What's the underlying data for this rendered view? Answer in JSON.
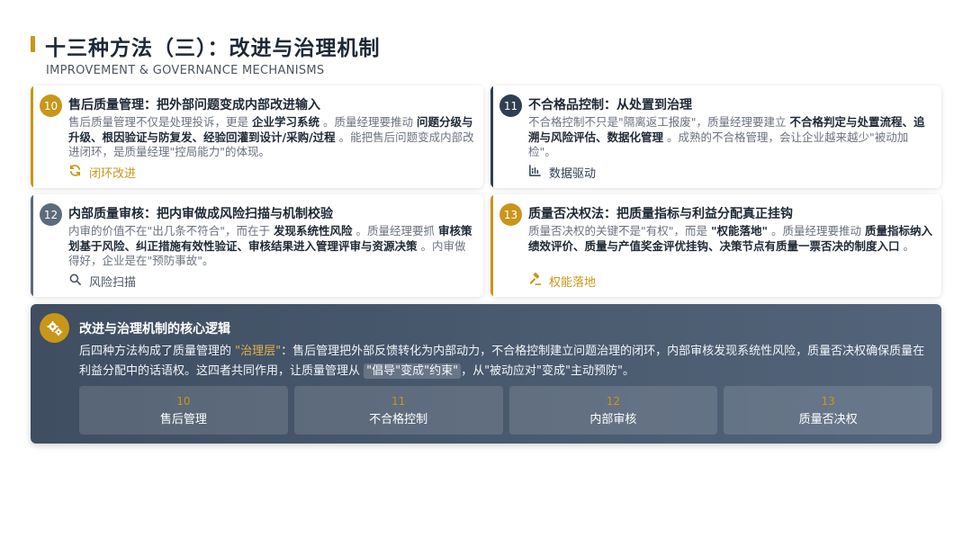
{
  "header": {
    "title": "十三种方法（三）：改进与治理机制",
    "subtitle": "IMPROVEMENT & GOVERNANCE MECHANISMS"
  },
  "colors": {
    "gold": "#c9961a",
    "navy": "#2f3f52",
    "grey": "#5c6b7c"
  },
  "cards": [
    {
      "number": "10",
      "title": "售后质量管理：把外部问题变成内部改进输入",
      "body": [
        {
          "t": "售后质量管理不仅是处理投诉，更是 "
        },
        {
          "b": "企业学习系统"
        },
        {
          "t": " 。质量经理要推动 "
        },
        {
          "b": "问题分级与升级、根因验证与防复发、经验回灌到设计/采购/过程"
        },
        {
          "t": " 。能把售后问题变成内部改进闭环，是质量经理\"控局能力\"的体现。"
        }
      ],
      "tag": "闭环改进",
      "tag_icon": "refresh-icon"
    },
    {
      "number": "11",
      "title": "不合格品控制：从处置到治理",
      "body": [
        {
          "t": "不合格控制不只是\"隔离返工报废\"，质量经理要建立 "
        },
        {
          "b": "不合格判定与处置流程、追溯与风险评估、数据化管理"
        },
        {
          "t": " 。成熟的不合格管理，会让企业越来越少\"被动加检\"。"
        }
      ],
      "tag": "数据驱动",
      "tag_icon": "bar-chart-icon"
    },
    {
      "number": "12",
      "title": "内部质量审核：把内审做成风险扫描与机制校验",
      "body": [
        {
          "t": "内审的价值不在\"出几条不符合\"，而在于 "
        },
        {
          "b": "发现系统性风险"
        },
        {
          "t": " 。质量经理要抓 "
        },
        {
          "b": "审核策划基于风险、纠正措施有效性验证、审核结果进入管理评审与资源决策"
        },
        {
          "t": " 。内审做得好，企业是在\"预防事故\"。"
        }
      ],
      "tag": "风险扫描",
      "tag_icon": "search-icon"
    },
    {
      "number": "13",
      "title": "质量否决权法：把质量指标与利益分配真正挂钩",
      "body": [
        {
          "t": "质量否决权的关键不是\"有权\"，而是 "
        },
        {
          "b": "\"权能落地\""
        },
        {
          "t": " 。质量经理要推动 "
        },
        {
          "b": "质量指标纳入绩效评价、质量与产值奖金评优挂钩、决策节点有质量一票否决的制度入口"
        },
        {
          "t": " 。"
        }
      ],
      "tag": "权能落地",
      "tag_icon": "gavel-icon"
    }
  ],
  "summary": {
    "icon": "gears-icon",
    "title": "改进与治理机制的核心逻辑",
    "text_1": "后四种方法构成了质量管理的 ",
    "highlight": "\"治理层\"",
    "text_2": "：售后管理把外部反馈转化为内部动力，不合格控制建立问题治理的闭环，内部审核发现系统性风险，质量否决权确保质量在利益分配中的话语权。这四者共同作用，让质量管理从 ",
    "boxed": "\"倡导\"变成\"约束\"",
    "text_3": "，从\"被动应对\"变成\"主动预防\"。",
    "steps": [
      {
        "number": "10",
        "label": "售后管理"
      },
      {
        "number": "11",
        "label": "不合格控制"
      },
      {
        "number": "12",
        "label": "内部审核"
      },
      {
        "number": "13",
        "label": "质量否决权"
      }
    ]
  }
}
